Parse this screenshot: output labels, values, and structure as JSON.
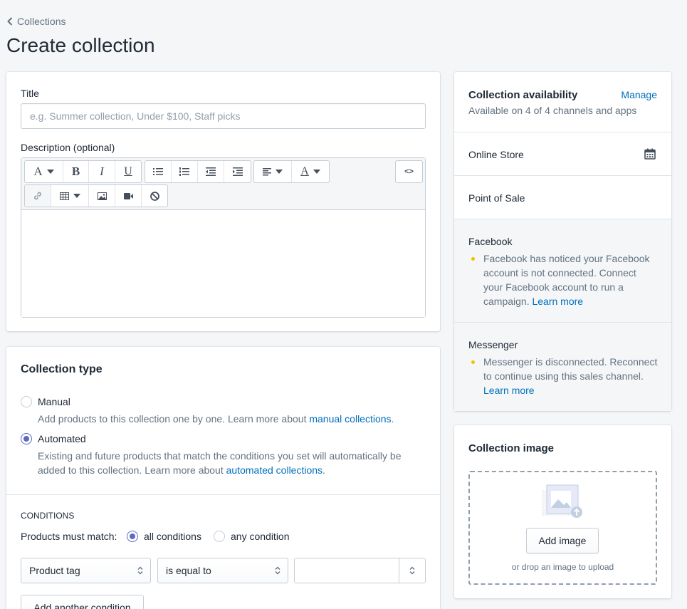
{
  "breadcrumb": {
    "label": "Collections"
  },
  "page": {
    "title": "Create collection"
  },
  "details": {
    "title_label": "Title",
    "title_placeholder": "e.g. Summer collection, Under $100, Staff picks",
    "title_value": "",
    "description_label": "Description (optional)",
    "toolbar": {
      "font_glyph": "A",
      "bold_glyph": "B",
      "italic_glyph": "I",
      "underline_glyph": "U",
      "color_glyph": "A",
      "html_glyph": "<>",
      "icons": [
        "font-icon",
        "bold-icon",
        "italic-icon",
        "underline-icon",
        "bulleted-list-icon",
        "numbered-list-icon",
        "outdent-icon",
        "indent-icon",
        "align-icon",
        "text-color-icon",
        "html-code-icon",
        "link-icon",
        "table-icon",
        "image-icon",
        "video-icon",
        "clear-format-icon"
      ]
    }
  },
  "collection_type": {
    "title": "Collection type",
    "manual": {
      "label": "Manual",
      "help_prefix": "Add products to this collection one by one. Learn more about ",
      "help_link": "manual collections",
      "help_suffix": ".",
      "selected": false
    },
    "automated": {
      "label": "Automated",
      "help_line1": "Existing and future products that match the conditions you set will automatically be",
      "help_line2_prefix": "added to this collection. Learn more about ",
      "help_link": "automated collections",
      "help_suffix": ".",
      "selected": true
    },
    "conditions": {
      "heading": "CONDITIONS",
      "match_label": "Products must match:",
      "all_label": "all conditions",
      "any_label": "any condition",
      "match_value": "all",
      "field_value": "Product tag",
      "operator_value": "is equal to",
      "value": "",
      "add_button": "Add another condition"
    }
  },
  "availability": {
    "title": "Collection availability",
    "manage_label": "Manage",
    "summary": "Available on 4 of 4 channels and apps",
    "channels": {
      "online_store": "Online Store",
      "pos": "Point of Sale",
      "facebook": {
        "name": "Facebook",
        "line1": "Facebook has noticed your Facebook",
        "line2": "account is not connected. Connect",
        "line3": "your Facebook account to run a",
        "line4_prefix": "campaign. ",
        "link": "Learn more"
      },
      "messenger": {
        "name": "Messenger",
        "line1": "Messenger is disconnected. Reconnect",
        "line2": "to continue using this sales channel.",
        "link": "Learn more"
      }
    }
  },
  "image": {
    "title": "Collection image",
    "add_button": "Add image",
    "drop_hint": "or drop an image to upload"
  },
  "colors": {
    "link": "#006fbb",
    "radio": "#5c6ac4",
    "warning_bullet": "#eec200",
    "background": "#f4f6f8"
  }
}
